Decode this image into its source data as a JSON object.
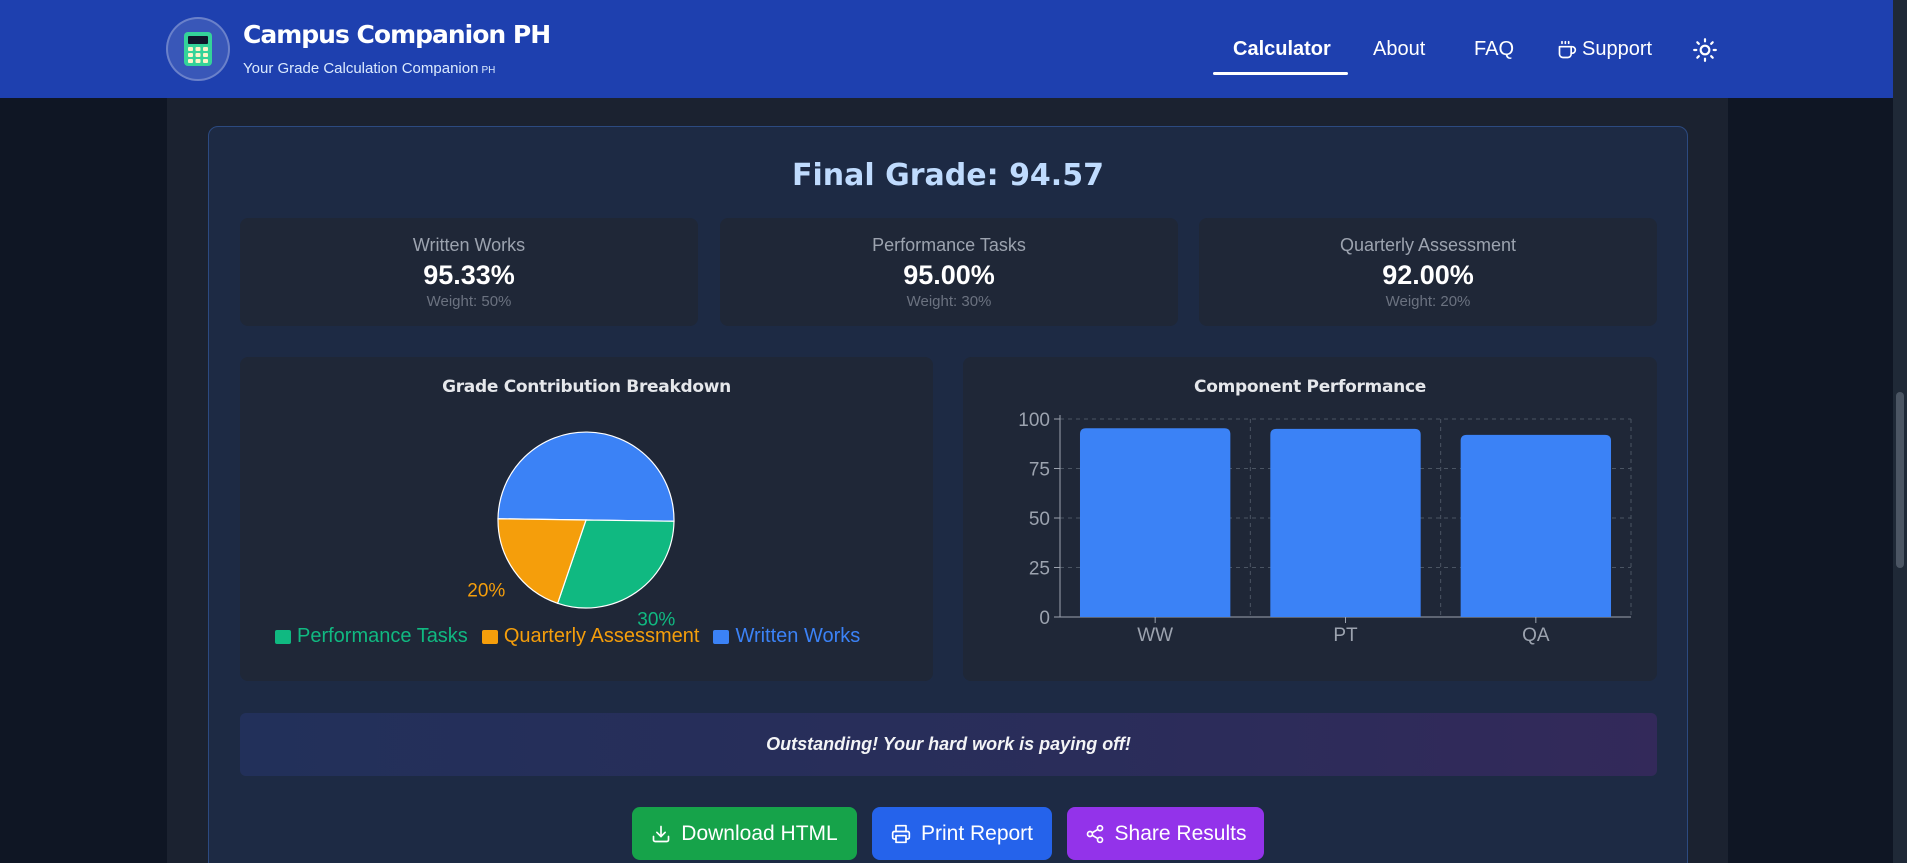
{
  "header": {
    "brand_title": "Campus Companion PH",
    "brand_subtitle": "Your Grade Calculation Companion",
    "brand_subtitle_suffix": "PH",
    "nav": {
      "calculator": "Calculator",
      "about": "About",
      "faq": "FAQ",
      "support": "Support"
    }
  },
  "results": {
    "final_grade": "Final Grade: 94.57",
    "components": [
      {
        "label": "Written Works",
        "value": "95.33%",
        "weight": "Weight: 50%"
      },
      {
        "label": "Performance Tasks",
        "value": "95.00%",
        "weight": "Weight: 30%"
      },
      {
        "label": "Quarterly Assessment",
        "value": "92.00%",
        "weight": "Weight: 20%"
      }
    ],
    "message": "Outstanding! Your hard work is paying off!"
  },
  "chart_data": [
    {
      "type": "pie",
      "title": "Grade Contribution Breakdown",
      "labels": [
        "Written Works",
        "Performance Tasks",
        "Quarterly Assessment"
      ],
      "values": [
        50,
        30,
        20
      ],
      "data_labels": [
        "",
        "30%",
        "20%"
      ],
      "legend": [
        "Performance Tasks",
        "Quarterly Assessment",
        "Written Works"
      ],
      "legend_placement": "bottom",
      "colors": {
        "Written Works": "#3b82f6",
        "Performance Tasks": "#10b981",
        "Quarterly Assessment": "#f59e0b"
      }
    },
    {
      "type": "bar",
      "title": "Component Performance",
      "categories": [
        "WW",
        "PT",
        "QA"
      ],
      "values": [
        95.33,
        95.0,
        92.0
      ],
      "ylim": [
        0,
        100
      ],
      "yticks": [
        0,
        25,
        50,
        75,
        100
      ],
      "grid": true,
      "color": "#3b82f6"
    }
  ],
  "actions": {
    "download": "Download HTML",
    "print": "Print Report",
    "share": "Share Results"
  },
  "icons": {
    "logo": "calculator-icon",
    "support": "coffee-cup-icon",
    "theme": "sun-icon",
    "download": "download-icon",
    "print": "printer-icon",
    "share": "share-icon"
  }
}
